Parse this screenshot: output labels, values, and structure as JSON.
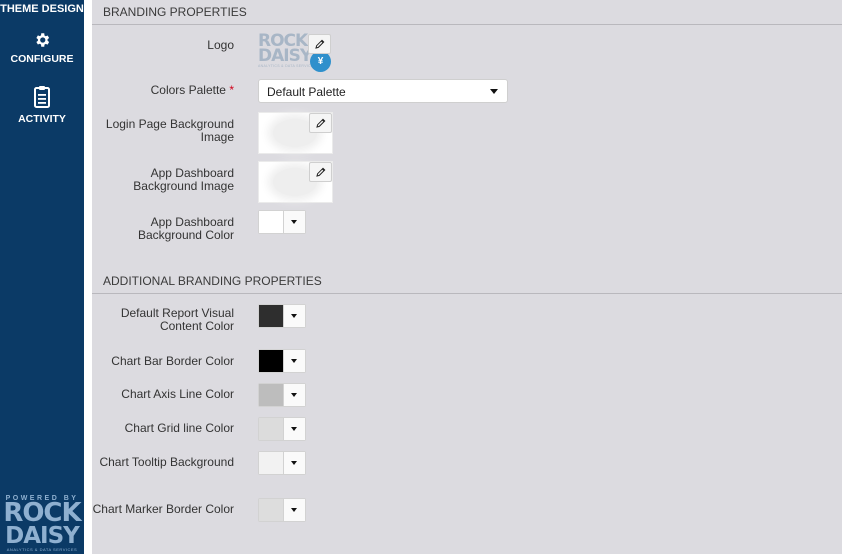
{
  "sidebar": {
    "title": "THEME DESIGN",
    "items": [
      {
        "label": "CONFIGURE",
        "icon": "gear-icon"
      },
      {
        "label": "ACTIVITY",
        "icon": "clipboard-icon"
      }
    ],
    "powered": {
      "by": "POWERED BY",
      "rock": "ROCK",
      "daisy": "DAISY",
      "tagline": "ANALYTICS & DATA SERVICES"
    }
  },
  "branding": {
    "heading": "BRANDING PROPERTIES",
    "logo_label": "Logo",
    "logo": {
      "rock": "ROCK",
      "daisy": "DAISY",
      "tagline": "ANALYTICS & DATA SERVICES",
      "badge": "¥"
    },
    "palette_label": "Colors Palette",
    "palette_required": "*",
    "palette_value": "Default Palette",
    "login_bg_label": "Login Page Background Image",
    "dash_bg_label": "App Dashboard Background Image",
    "dash_color_label": "App Dashboard Background Color",
    "dash_color": "#ffffff"
  },
  "additional": {
    "heading": "ADDITIONAL BRANDING PROPERTIES",
    "rows": [
      {
        "label": "Default Report Visual Content Color",
        "color": "#2e2e2e"
      },
      {
        "label": "Chart Bar Border Color",
        "color": "#000000"
      },
      {
        "label": "Chart Axis Line Color",
        "color": "#bdbdbd"
      },
      {
        "label": "Chart Grid line Color",
        "color": "#dcdcdc"
      },
      {
        "label": "Chart Tooltip Background",
        "color": "#f2f2f2"
      },
      {
        "label": "Chart Marker Border Color",
        "color": "#dddddd"
      }
    ]
  }
}
